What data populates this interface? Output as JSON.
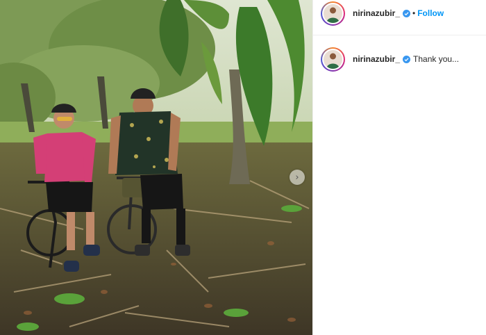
{
  "post": {
    "author": {
      "username": "nirinazubir_",
      "verified": true
    },
    "header": {
      "separator": "•",
      "follow_label": "Follow"
    },
    "caption": {
      "username": "nirinazubir_",
      "text": "Thank you..."
    },
    "media": {
      "next_glyph": "›"
    },
    "colors": {
      "follow_blue": "#0095f6",
      "verified_blue": "#3897f0",
      "story_ring": [
        "#f58529",
        "#dd2a7b",
        "#8134af",
        "#515bd4"
      ]
    }
  }
}
